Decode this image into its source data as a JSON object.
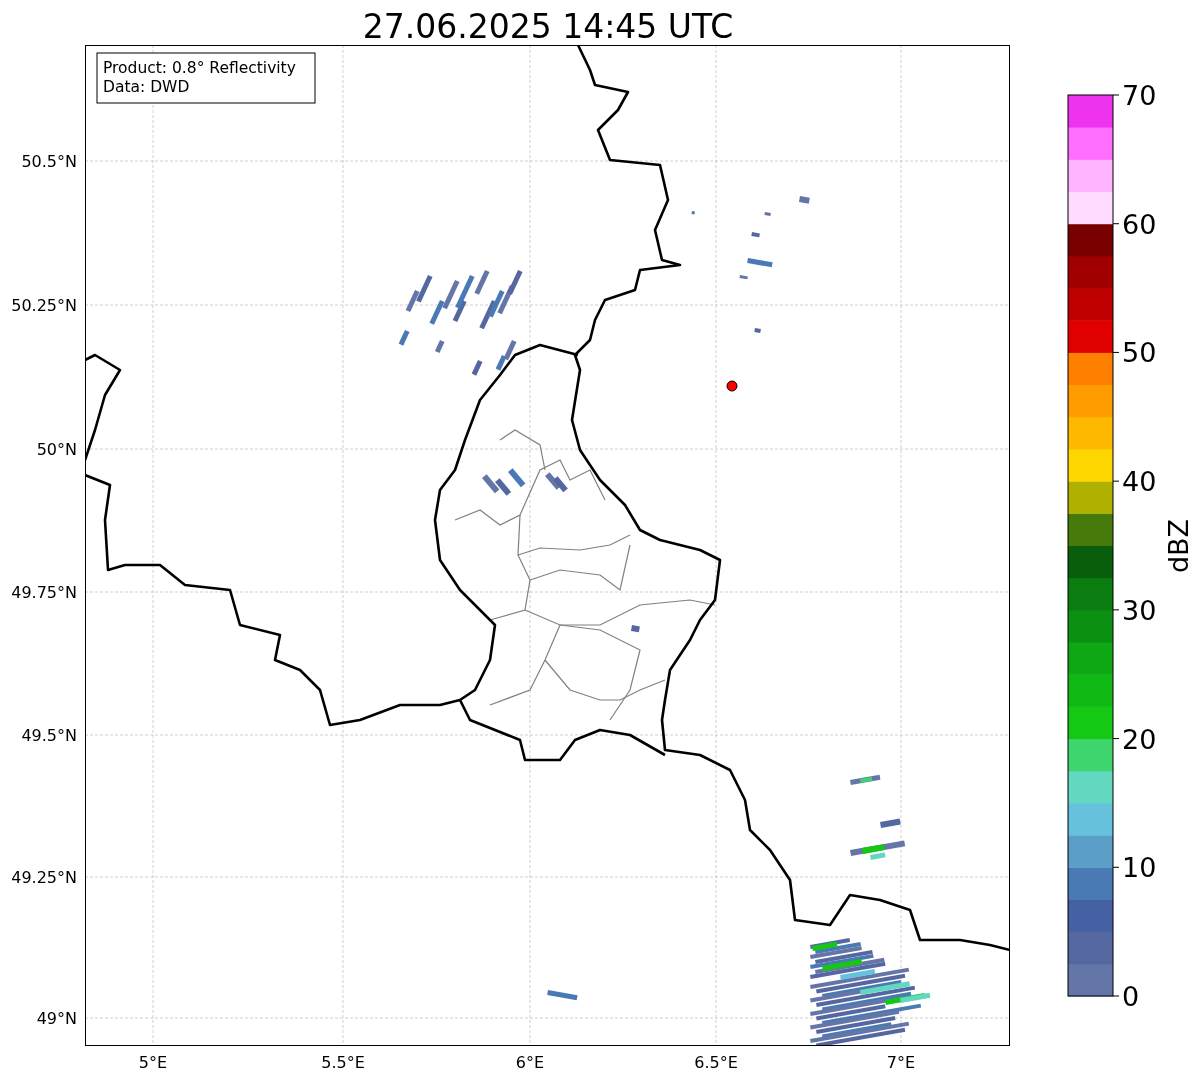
{
  "title": "27.06.2025 14:45 UTC",
  "info_box": [
    "Product: 0.8° Reflectivity",
    "Data: DWD"
  ],
  "map": {
    "x_ticks": [
      "5°E",
      "5.5°E",
      "6°E",
      "6.5°E",
      "7°E"
    ],
    "y_ticks": [
      "50.5°N",
      "50.25°N",
      "50°N",
      "49.75°N",
      "49.5°N",
      "49.25°N",
      "49°N"
    ]
  },
  "colorbar": {
    "label": "dBZ",
    "ticks": [
      "70",
      "60",
      "50",
      "40",
      "30",
      "20",
      "10",
      "0"
    ],
    "segments": [
      {
        "color": "#6476a8"
      },
      {
        "color": "#5567a0"
      },
      {
        "color": "#4560a3"
      },
      {
        "color": "#4a7ab4"
      },
      {
        "color": "#5b9fc8"
      },
      {
        "color": "#66c2dc"
      },
      {
        "color": "#62d8c0"
      },
      {
        "color": "#3ed46e"
      },
      {
        "color": "#14c814"
      },
      {
        "color": "#10b814"
      },
      {
        "color": "#0ea814"
      },
      {
        "color": "#0c9012"
      },
      {
        "color": "#0a7c10"
      },
      {
        "color": "#085e0a"
      },
      {
        "color": "#467a0a"
      },
      {
        "color": "#b0b000"
      },
      {
        "color": "#ffd700"
      },
      {
        "color": "#ffb800"
      },
      {
        "color": "#ff9c00"
      },
      {
        "color": "#ff7f00"
      },
      {
        "color": "#e00000"
      },
      {
        "color": "#c00000"
      },
      {
        "color": "#a00000"
      },
      {
        "color": "#780000"
      },
      {
        "color": "#ffdcff"
      },
      {
        "color": "#ffb4ff"
      },
      {
        "color": "#ff6eff"
      },
      {
        "color": "#ee32ee"
      }
    ]
  }
}
